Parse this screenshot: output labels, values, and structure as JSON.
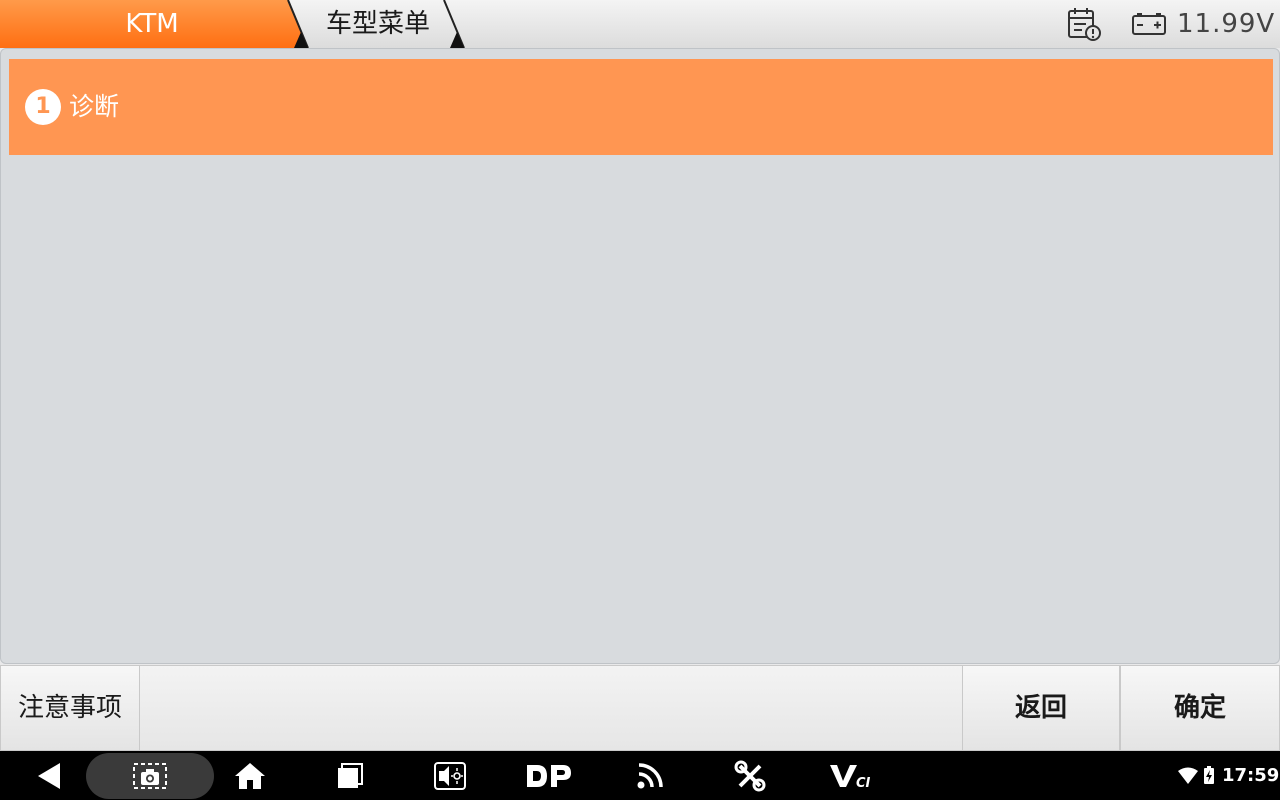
{
  "header": {
    "breadcrumb": [
      {
        "label": "KTM"
      },
      {
        "label": "车型菜单"
      }
    ],
    "voltage": "11.99V",
    "icons": [
      "calendar-alert-icon",
      "battery-icon"
    ]
  },
  "menu": {
    "items": [
      {
        "index": "1",
        "label": "诊断",
        "selected": true
      }
    ]
  },
  "footer": {
    "notes_label": "注意事项",
    "back_label": "返回",
    "ok_label": "确定"
  },
  "navbar": {
    "icons": [
      "back-icon",
      "screenshot-icon",
      "home-icon",
      "recents-icon",
      "brightness-icon",
      "dp-icon",
      "feed-icon",
      "tools-icon",
      "vci-icon"
    ],
    "status_icons": [
      "wifi-icon",
      "battery-charging-icon"
    ],
    "time": "17:59"
  },
  "colors": {
    "accent": "#ff9652",
    "brand_tab": "#ff7a22",
    "content_bg": "#d8dbde"
  }
}
